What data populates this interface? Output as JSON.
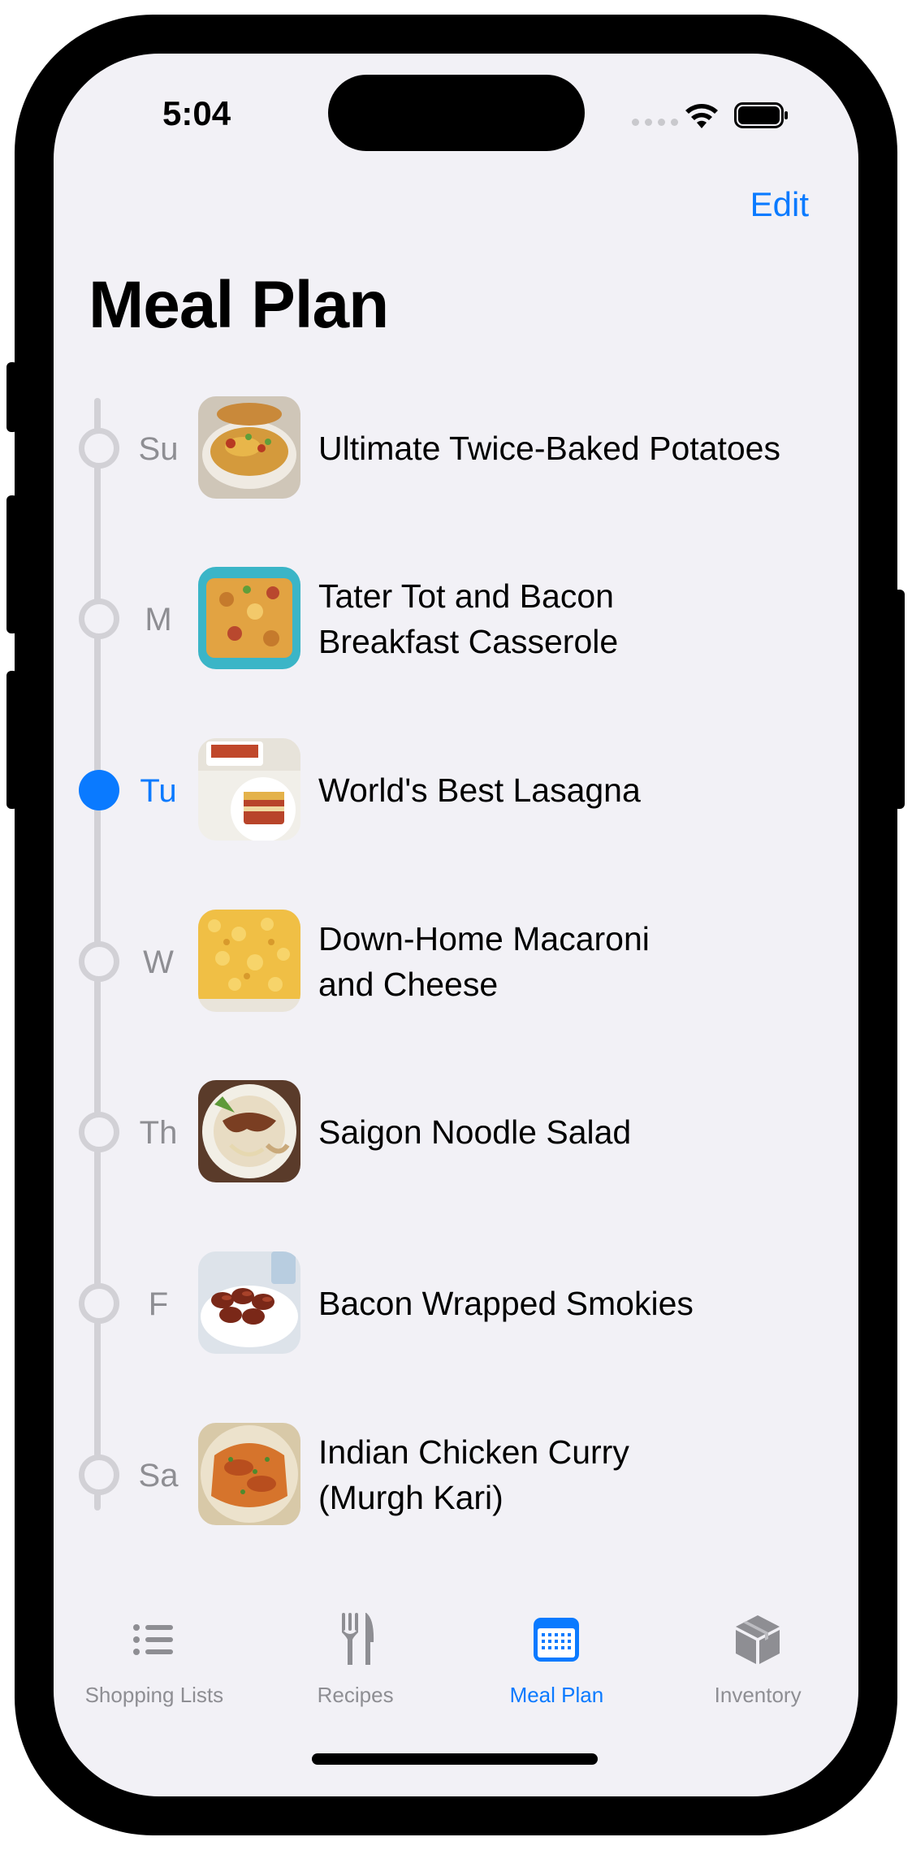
{
  "status_bar": {
    "time": "5:04"
  },
  "header": {
    "edit_label": "Edit",
    "title": "Meal Plan"
  },
  "meal_plan": {
    "days": [
      {
        "day": "Su",
        "recipe": "Ultimate Twice-Baked Potatoes",
        "active": false
      },
      {
        "day": "M",
        "recipe": "Tater Tot and Bacon\nBreakfast Casserole",
        "active": false
      },
      {
        "day": "Tu",
        "recipe": "World's Best Lasagna",
        "active": true
      },
      {
        "day": "W",
        "recipe": "Down-Home Macaroni\nand Cheese",
        "active": false
      },
      {
        "day": "Th",
        "recipe": "Saigon Noodle Salad",
        "active": false
      },
      {
        "day": "F",
        "recipe": "Bacon Wrapped Smokies",
        "active": false
      },
      {
        "day": "Sa",
        "recipe": "Indian Chicken Curry\n(Murgh Kari)",
        "active": false
      }
    ]
  },
  "tab_bar": {
    "tabs": [
      {
        "label": "Shopping Lists",
        "icon": "list-icon",
        "active": false
      },
      {
        "label": "Recipes",
        "icon": "fork-knife-icon",
        "active": false
      },
      {
        "label": "Meal Plan",
        "icon": "calendar-icon",
        "active": true
      },
      {
        "label": "Inventory",
        "icon": "box-icon",
        "active": false
      }
    ]
  },
  "colors": {
    "accent": "#0a7aff",
    "background": "#f2f1f6",
    "inactive": "#8e8e93",
    "timeline": "#d2d1d6"
  }
}
